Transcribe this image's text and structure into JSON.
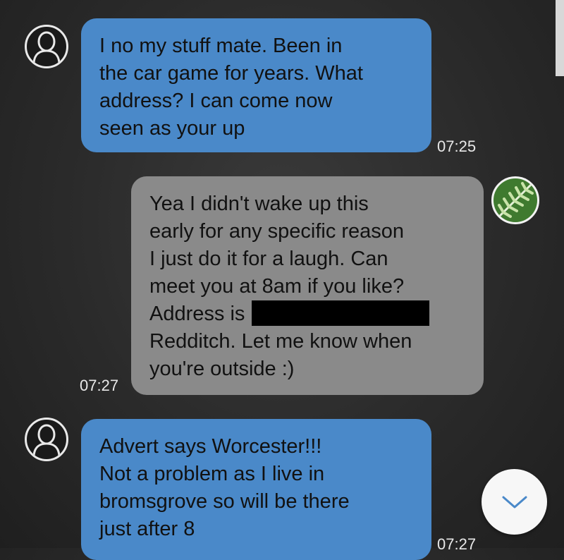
{
  "messages": [
    {
      "side": "incoming",
      "lines": [
        "I no my stuff mate. Been in",
        "the car game for years. What",
        "address? I can come now",
        "seen as your up"
      ],
      "time": "07:25",
      "avatar": "person-silhouette-icon"
    },
    {
      "side": "outgoing",
      "lines": [
        "Yea I didn't wake up this",
        "early for any specific reason",
        "I just do it for a laugh. Can",
        "meet you at 8am if you like?",
        "Address is",
        "Redditch. Let me know when",
        "you're outside :)"
      ],
      "redacted_after_line": 4,
      "time": "07:27",
      "avatar": "fern-leaf-icon"
    },
    {
      "side": "incoming",
      "lines": [
        "Advert says Worcester!!!",
        "Not a problem as I live in",
        "bromsgrove so will be there",
        "just after 8"
      ],
      "time": "07:27",
      "avatar": "person-silhouette-icon"
    }
  ],
  "scroll_button_icon": "chevron-down-icon",
  "colors": {
    "incoming_bubble": "#4a89c9",
    "outgoing_bubble": "#8a8a8a",
    "background": "#2a2a2a",
    "timestamp": "#e8e8e8"
  }
}
